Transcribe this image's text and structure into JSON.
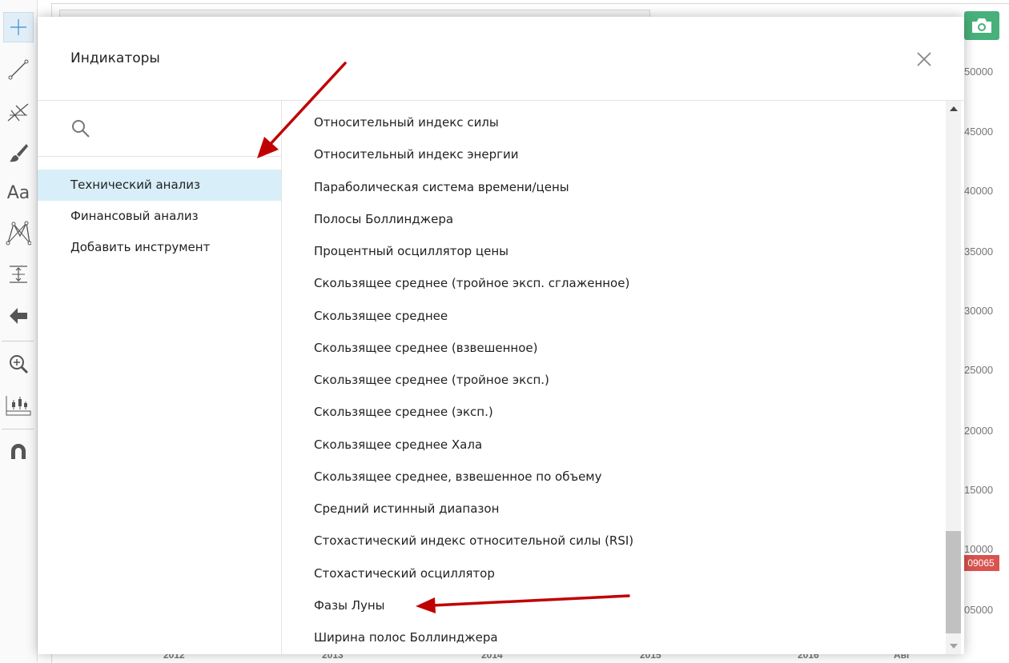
{
  "dialog": {
    "title": "Индикаторы",
    "search_placeholder": ""
  },
  "categories": [
    {
      "label": "Технический анализ",
      "active": true
    },
    {
      "label": "Финансовый анализ",
      "active": false
    },
    {
      "label": "Добавить инструмент",
      "active": false
    }
  ],
  "indicators": [
    "Относительный индекс силы",
    "Относительный индекс энергии",
    "Параболическая система времени/цены",
    "Полосы Боллинджера",
    "Процентный осциллятор цены",
    "Скользящее среднее (тройное эксп. сглаженное)",
    "Скользящее среднее",
    "Скользящее среднее (взвешенное)",
    "Скользящее среднее (тройное эксп.)",
    "Скользящее среднее (эксп.)",
    "Скользящее среднее Хала",
    "Скользящее среднее, взвешенное по объему",
    "Средний истинный диапазон",
    "Стохастический индекс относительной силы (RSI)",
    "Стохастический осциллятор",
    "Фазы Луны",
    "Ширина полос Боллинджера"
  ],
  "toolbar": {
    "text_tool_label": "Aa"
  },
  "chart": {
    "price_labels": [
      "50000",
      "45000",
      "40000",
      "35000",
      "30000",
      "25000",
      "20000",
      "15000",
      "10000",
      "05000"
    ],
    "current_price": "09065",
    "years": [
      "2012",
      "2013",
      "2014",
      "2015",
      "2016",
      "Авг"
    ]
  },
  "colors": {
    "accent_active": "#d8eef8",
    "camera_button": "#48b07b",
    "price_marker": "#d9534f",
    "annotation_arrow": "#c00000"
  },
  "icons": {
    "crosshair": "crosshair-icon",
    "trend_line": "trend-line-icon",
    "pitchfork": "pitchfork-icon",
    "brush": "brush-icon",
    "pattern": "pattern-icon",
    "measure": "measure-icon",
    "back_arrow": "arrow-left-icon",
    "zoom": "zoom-in-icon",
    "ruler_chart": "ruler-chart-icon",
    "magnet": "magnet-icon",
    "camera": "camera-icon",
    "search": "search-icon",
    "close": "close-icon"
  }
}
